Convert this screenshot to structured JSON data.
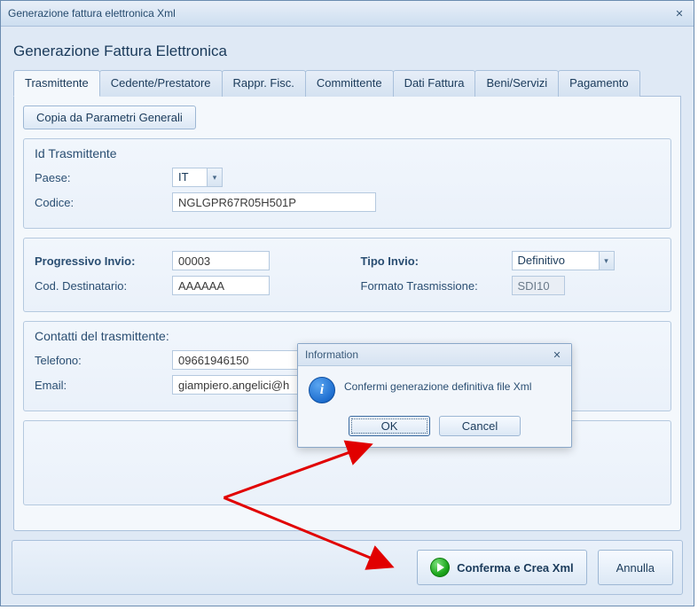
{
  "window": {
    "title": "Generazione fattura elettronica Xml",
    "close_glyph": "✕"
  },
  "panel_title": "Generazione Fattura Elettronica",
  "tabs": [
    {
      "label": "Trasmittente",
      "active": true
    },
    {
      "label": "Cedente/Prestatore"
    },
    {
      "label": "Rappr. Fisc."
    },
    {
      "label": "Committente"
    },
    {
      "label": "Dati Fattura"
    },
    {
      "label": "Beni/Servizi"
    },
    {
      "label": "Pagamento"
    }
  ],
  "copy_button": "Copia da Parametri Generali",
  "id_trasmittente": {
    "title": "Id Trasmittente",
    "paese_label": "Paese:",
    "paese_value": "IT",
    "codice_label": "Codice:",
    "codice_value": "NGLGPR67R05H501P"
  },
  "invio": {
    "progressivo_label": "Progressivo Invio:",
    "progressivo_value": "00003",
    "cod_dest_label": "Cod. Destinatario:",
    "cod_dest_value": "AAAAAA",
    "tipo_invio_label": "Tipo Invio:",
    "tipo_invio_value": "Definitivo",
    "formato_label": "Formato Trasmissione:",
    "formato_value": "SDI10"
  },
  "contatti": {
    "title": "Contatti del trasmittente:",
    "telefono_label": "Telefono:",
    "telefono_value": "09661946150",
    "email_label": "Email:",
    "email_value": "giampiero.angelici@h"
  },
  "footer": {
    "confirm_label": "Conferma e Crea Xml",
    "cancel_label": "Annulla"
  },
  "dialog": {
    "title": "Information",
    "close_glyph": "✕",
    "message": "Confermi generazione definitiva file Xml",
    "ok": "OK",
    "cancel": "Cancel"
  }
}
